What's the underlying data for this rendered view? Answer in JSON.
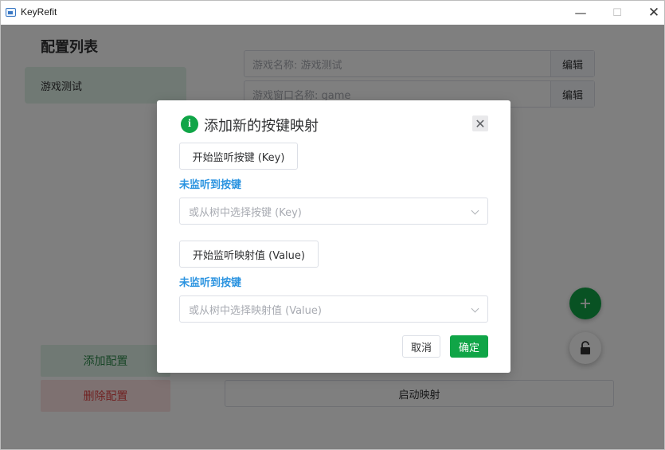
{
  "window": {
    "title": "KeyRefit",
    "minimize_glyph": "—",
    "maximize_glyph": "☐",
    "close_glyph": "✕"
  },
  "sidebar": {
    "title": "配置列表",
    "configs": [
      {
        "label": "游戏测试"
      }
    ],
    "add_config_label": "添加配置",
    "delete_config_label": "删除配置"
  },
  "main": {
    "game_name_text": "游戏名称: 游戏测试",
    "game_name_edit_label": "编辑",
    "window_name_text": "游戏窗口名称: game",
    "window_name_edit_label": "编辑",
    "start_mapping_label": "启动映射",
    "add_fab_icon": "plus-icon",
    "lock_fab_icon": "unlock-icon"
  },
  "dialog": {
    "title": "添加新的按键映射",
    "icon": "info-icon",
    "close_glyph": "✕",
    "listen_key_label": "开始监听按键 (Key)",
    "key_status": "未监听到按键",
    "key_select_placeholder": "或从树中选择按键 (Key)",
    "listen_value_label": "开始监听映射值 (Value)",
    "value_status": "未监听到按键",
    "value_select_placeholder": "或从树中选择映射值 (Value)",
    "cancel_label": "取消",
    "confirm_label": "确定"
  },
  "colors": {
    "accent": "#10a547",
    "status_blue": "#2a93e0",
    "danger": "#e04545"
  }
}
